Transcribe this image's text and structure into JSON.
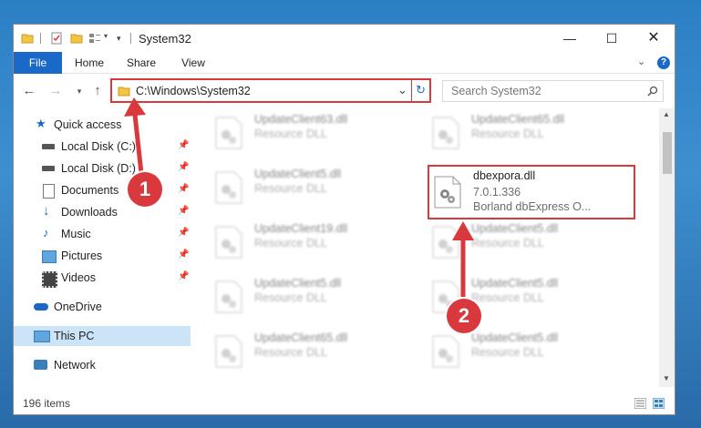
{
  "window": {
    "title": "System32"
  },
  "ribbon": {
    "tabs": [
      "File",
      "Home",
      "Share",
      "View"
    ]
  },
  "address": {
    "path": "C:\\Windows\\System32"
  },
  "search": {
    "placeholder": "Search System32"
  },
  "sidebar": {
    "items": [
      {
        "label": "Quick access",
        "icon": "star-icon",
        "pinned": false
      },
      {
        "label": "Local Disk (C:)",
        "icon": "drive-icon",
        "pinned": true
      },
      {
        "label": "Local Disk (D:)",
        "icon": "drive-icon",
        "pinned": true
      },
      {
        "label": "Documents",
        "icon": "documents-icon",
        "pinned": true
      },
      {
        "label": "Downloads",
        "icon": "download-icon",
        "pinned": true
      },
      {
        "label": "Music",
        "icon": "music-icon",
        "pinned": true
      },
      {
        "label": "Pictures",
        "icon": "pictures-icon",
        "pinned": true
      },
      {
        "label": "Videos",
        "icon": "videos-icon",
        "pinned": true
      },
      {
        "label": "OneDrive",
        "icon": "cloud-icon",
        "pinned": false
      },
      {
        "label": "This PC",
        "icon": "computer-icon",
        "pinned": false
      },
      {
        "label": "Network",
        "icon": "network-icon",
        "pinned": false
      }
    ]
  },
  "files": [
    {
      "name": "UpdateClient63.dll",
      "sub1": "Resource DLL",
      "sub2": ""
    },
    {
      "name": "UpdateClient65.dll",
      "sub1": "Resource DLL",
      "sub2": ""
    },
    {
      "name": "UpdateClient5.dll",
      "sub1": "Resource DLL",
      "sub2": ""
    },
    {
      "name": "dbexpora.dll",
      "sub1": "7.0.1.336",
      "sub2": "Borland dbExpress O..."
    },
    {
      "name": "UpdateClient19.dll",
      "sub1": "Resource DLL",
      "sub2": ""
    },
    {
      "name": "UpdateClient5.dll",
      "sub1": "Resource DLL",
      "sub2": ""
    },
    {
      "name": "UpdateClient5.dll",
      "sub1": "Resource DLL",
      "sub2": ""
    },
    {
      "name": "UpdateClient5.dll",
      "sub1": "Resource DLL",
      "sub2": ""
    },
    {
      "name": "UpdateClient65.dll",
      "sub1": "Resource DLL",
      "sub2": ""
    },
    {
      "name": "UpdateClient5.dll",
      "sub1": "Resource DLL",
      "sub2": ""
    }
  ],
  "status": {
    "item_count": "196 items"
  },
  "markers": {
    "step1": "1",
    "step2": "2"
  },
  "colors": {
    "accent": "#1a69c8",
    "highlight": "#d9393c",
    "selected": "#cce4f7"
  }
}
